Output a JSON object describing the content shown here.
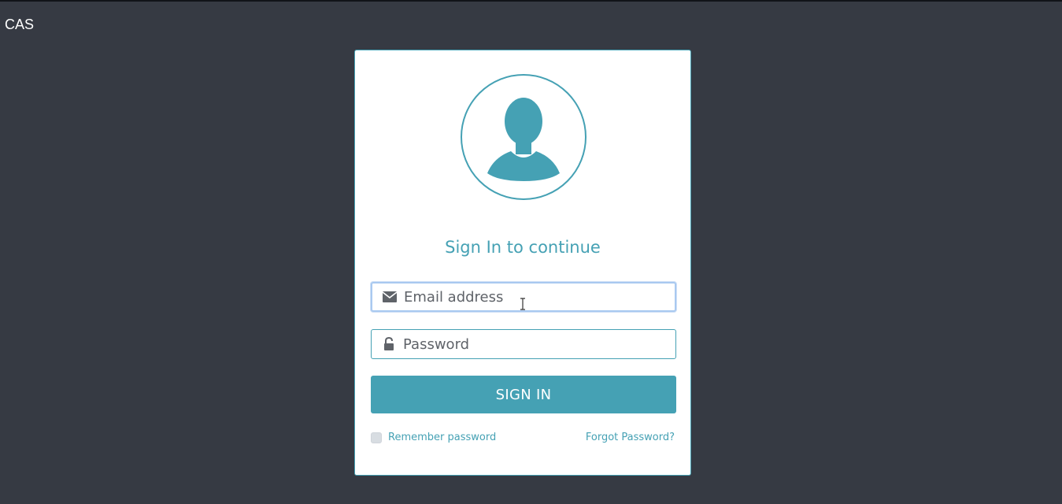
{
  "app": {
    "brand": "CAS"
  },
  "login": {
    "heading": "Sign In to continue",
    "email": {
      "placeholder": "Email address",
      "value": "",
      "icon": "envelope-icon"
    },
    "password": {
      "placeholder": "Password",
      "value": "",
      "icon": "unlock-icon"
    },
    "submit_label": "SIGN IN",
    "remember_label": "Remember password",
    "remember_checked": false,
    "forgot_label": "Forgot Password?",
    "avatar_icon": "user-silhouette-icon"
  },
  "theme": {
    "background": "#363a43",
    "accent": "#45a1b4",
    "card": "#ffffff"
  }
}
